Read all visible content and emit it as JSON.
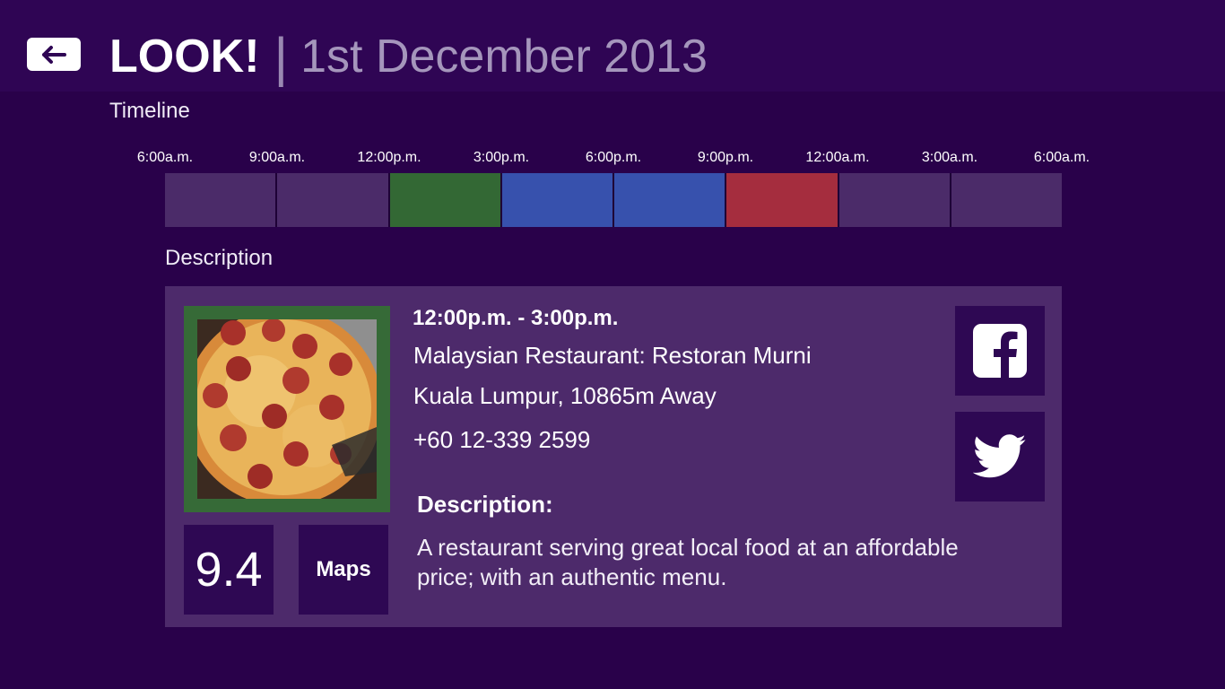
{
  "header": {
    "title": "LOOK!",
    "separator": "|",
    "date": "1st December 2013"
  },
  "timeline": {
    "label": "Timeline",
    "ticks": [
      "6:00a.m.",
      "9:00a.m.",
      "12:00p.m.",
      "3:00p.m.",
      "6:00p.m.",
      "9:00p.m.",
      "12:00a.m.",
      "3:00a.m.",
      "6:00a.m."
    ],
    "slot_colors": [
      "#4b2b69",
      "#4b2b69",
      "#336834",
      "#3751ad",
      "#3751ad",
      "#a52d3e",
      "#4b2b69",
      "#4b2b69"
    ]
  },
  "description_section": {
    "label": "Description"
  },
  "details": {
    "time_range": "12:00p.m. - 3:00p.m.",
    "name": "Malaysian Restaurant: Restoran Murni",
    "location": "Kuala Lumpur, 10865m Away",
    "phone": "+60 12-339 2599",
    "desc_heading": "Description:",
    "desc_body": "A restaurant serving great local food at an affordable price; with an authentic menu.",
    "rating": "9.4",
    "maps_label": "Maps",
    "photo_icon": "pizza-photo",
    "social_icons": [
      "facebook-icon",
      "twitter-icon"
    ]
  },
  "colors": {
    "background": "#29014a",
    "header": "#2f0554",
    "card": "#4d2a6b",
    "tile": "#2e0853",
    "photo_frame": "#366a37"
  }
}
